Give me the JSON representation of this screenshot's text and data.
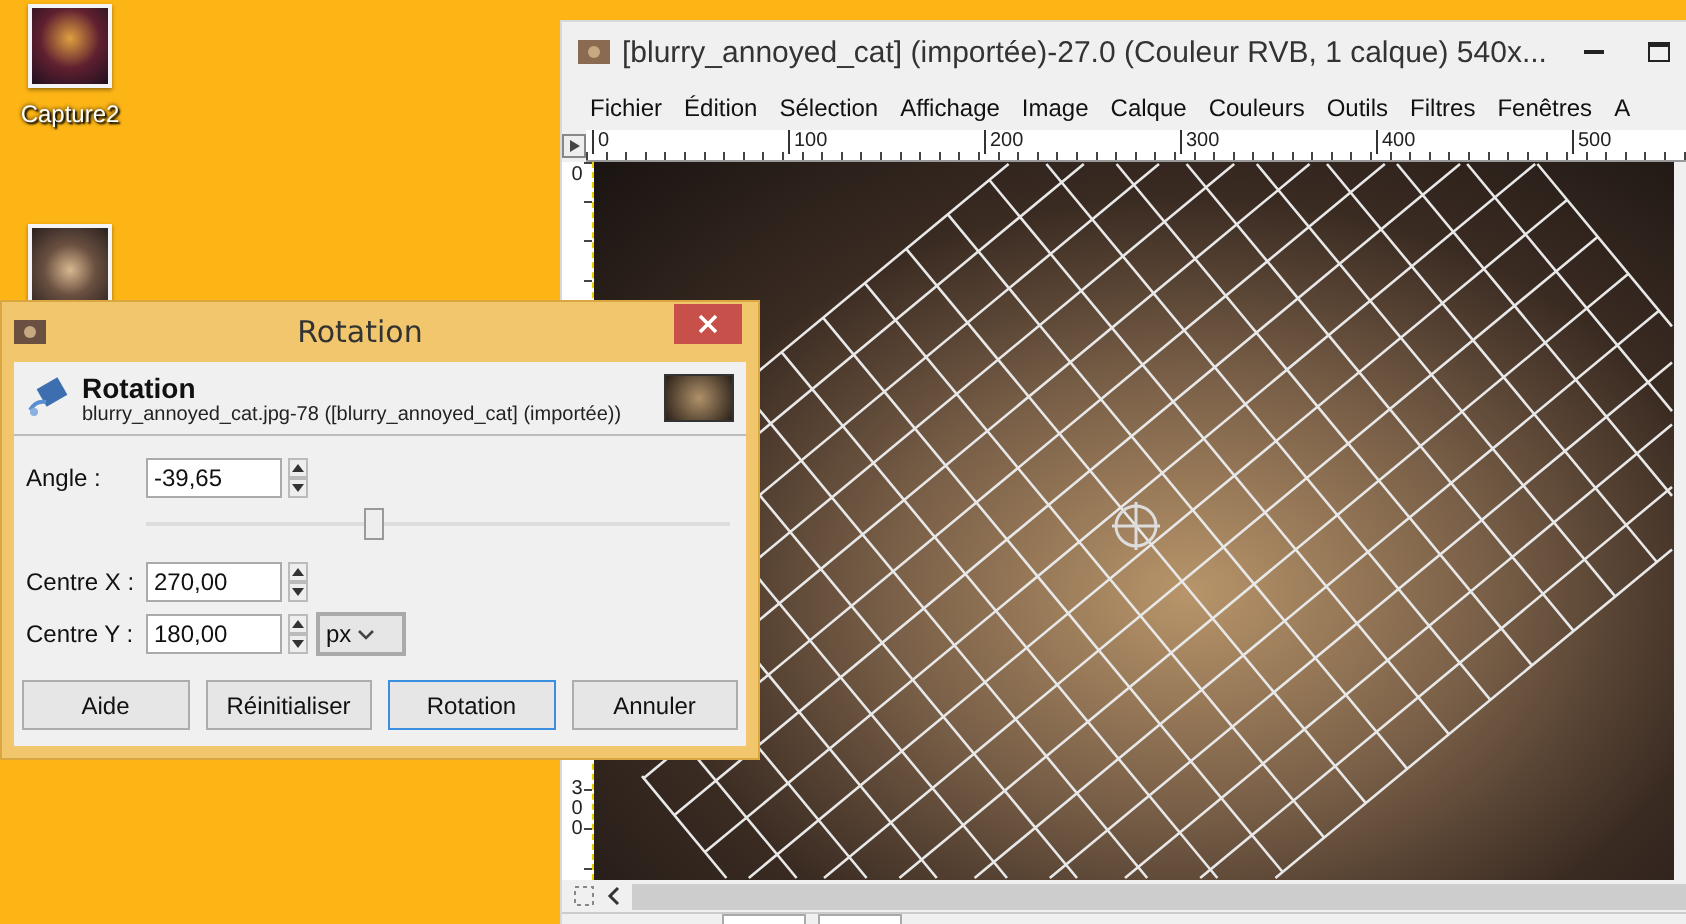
{
  "desktop": {
    "icons": [
      {
        "label": "Capture2"
      }
    ]
  },
  "image_window": {
    "title": "[blurry_annoyed_cat] (importée)-27.0 (Couleur RVB, 1 calque) 540x...",
    "menu": [
      "Fichier",
      "Édition",
      "Sélection",
      "Affichage",
      "Image",
      "Calque",
      "Couleurs",
      "Outils",
      "Filtres",
      "Fenêtres",
      "A"
    ],
    "top_ruler": [
      "0",
      "100",
      "200",
      "300",
      "400",
      "500"
    ],
    "left_ruler": [
      "0",
      "300"
    ]
  },
  "dialog": {
    "title": "Rotation",
    "header_title": "Rotation",
    "header_subtitle": "blurry_annoyed_cat.jpg-78 ([blurry_annoyed_cat] (importée))",
    "angle": {
      "label": "Angle :",
      "value": "-39,65",
      "level": 0.39
    },
    "centre_x": {
      "label": "Centre X :",
      "value": "270,00"
    },
    "centre_y": {
      "label": "Centre Y :",
      "value": "180,00"
    },
    "unit": "px",
    "buttons": [
      {
        "label": "Aide",
        "selected": false
      },
      {
        "label": "Réinitialiser",
        "selected": false
      },
      {
        "label": "Rotation",
        "selected": true
      },
      {
        "label": "Annuler",
        "selected": false
      }
    ]
  }
}
